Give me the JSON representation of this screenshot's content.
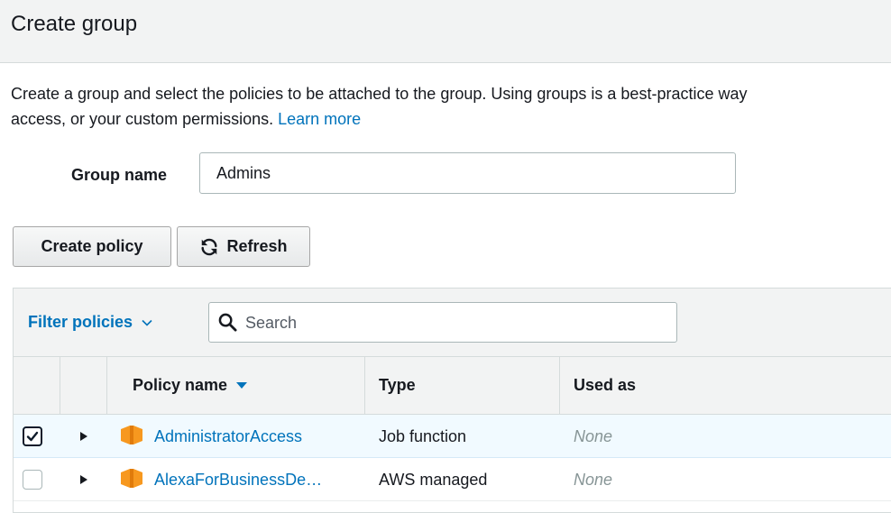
{
  "header": {
    "title": "Create group"
  },
  "description": {
    "text": "Create a group and select the policies to be attached to the group. Using groups is a best-practice way",
    "text2": "access, or your custom permissions.",
    "link": "Learn more"
  },
  "group_name": {
    "label": "Group name",
    "value": "Admins"
  },
  "buttons": {
    "create_policy": "Create policy",
    "refresh": "Refresh"
  },
  "filter": {
    "label": "Filter policies",
    "search_placeholder": "Search",
    "search_value": ""
  },
  "table": {
    "columns": [
      "Policy name",
      "Type",
      "Used as"
    ],
    "rows": [
      {
        "selected": true,
        "name": "AdministratorAccess",
        "type": "Job function",
        "used_as": "None"
      },
      {
        "selected": false,
        "name": "AlexaForBusinessDe…",
        "type": "AWS managed",
        "used_as": "None"
      }
    ]
  },
  "colors": {
    "link": "#0073bb",
    "header_bg": "#f2f3f3",
    "selected_row_bg": "#f1faff",
    "policy_icon": "#f7981f"
  },
  "icons": {
    "refresh": "refresh-icon",
    "search": "search-icon",
    "filter_dropdown": "chevron-down-icon",
    "sort": "sort-descending-icon",
    "expand": "caret-right-icon",
    "policy": "policy-cube-icon",
    "checkbox": "checkmark-icon"
  }
}
